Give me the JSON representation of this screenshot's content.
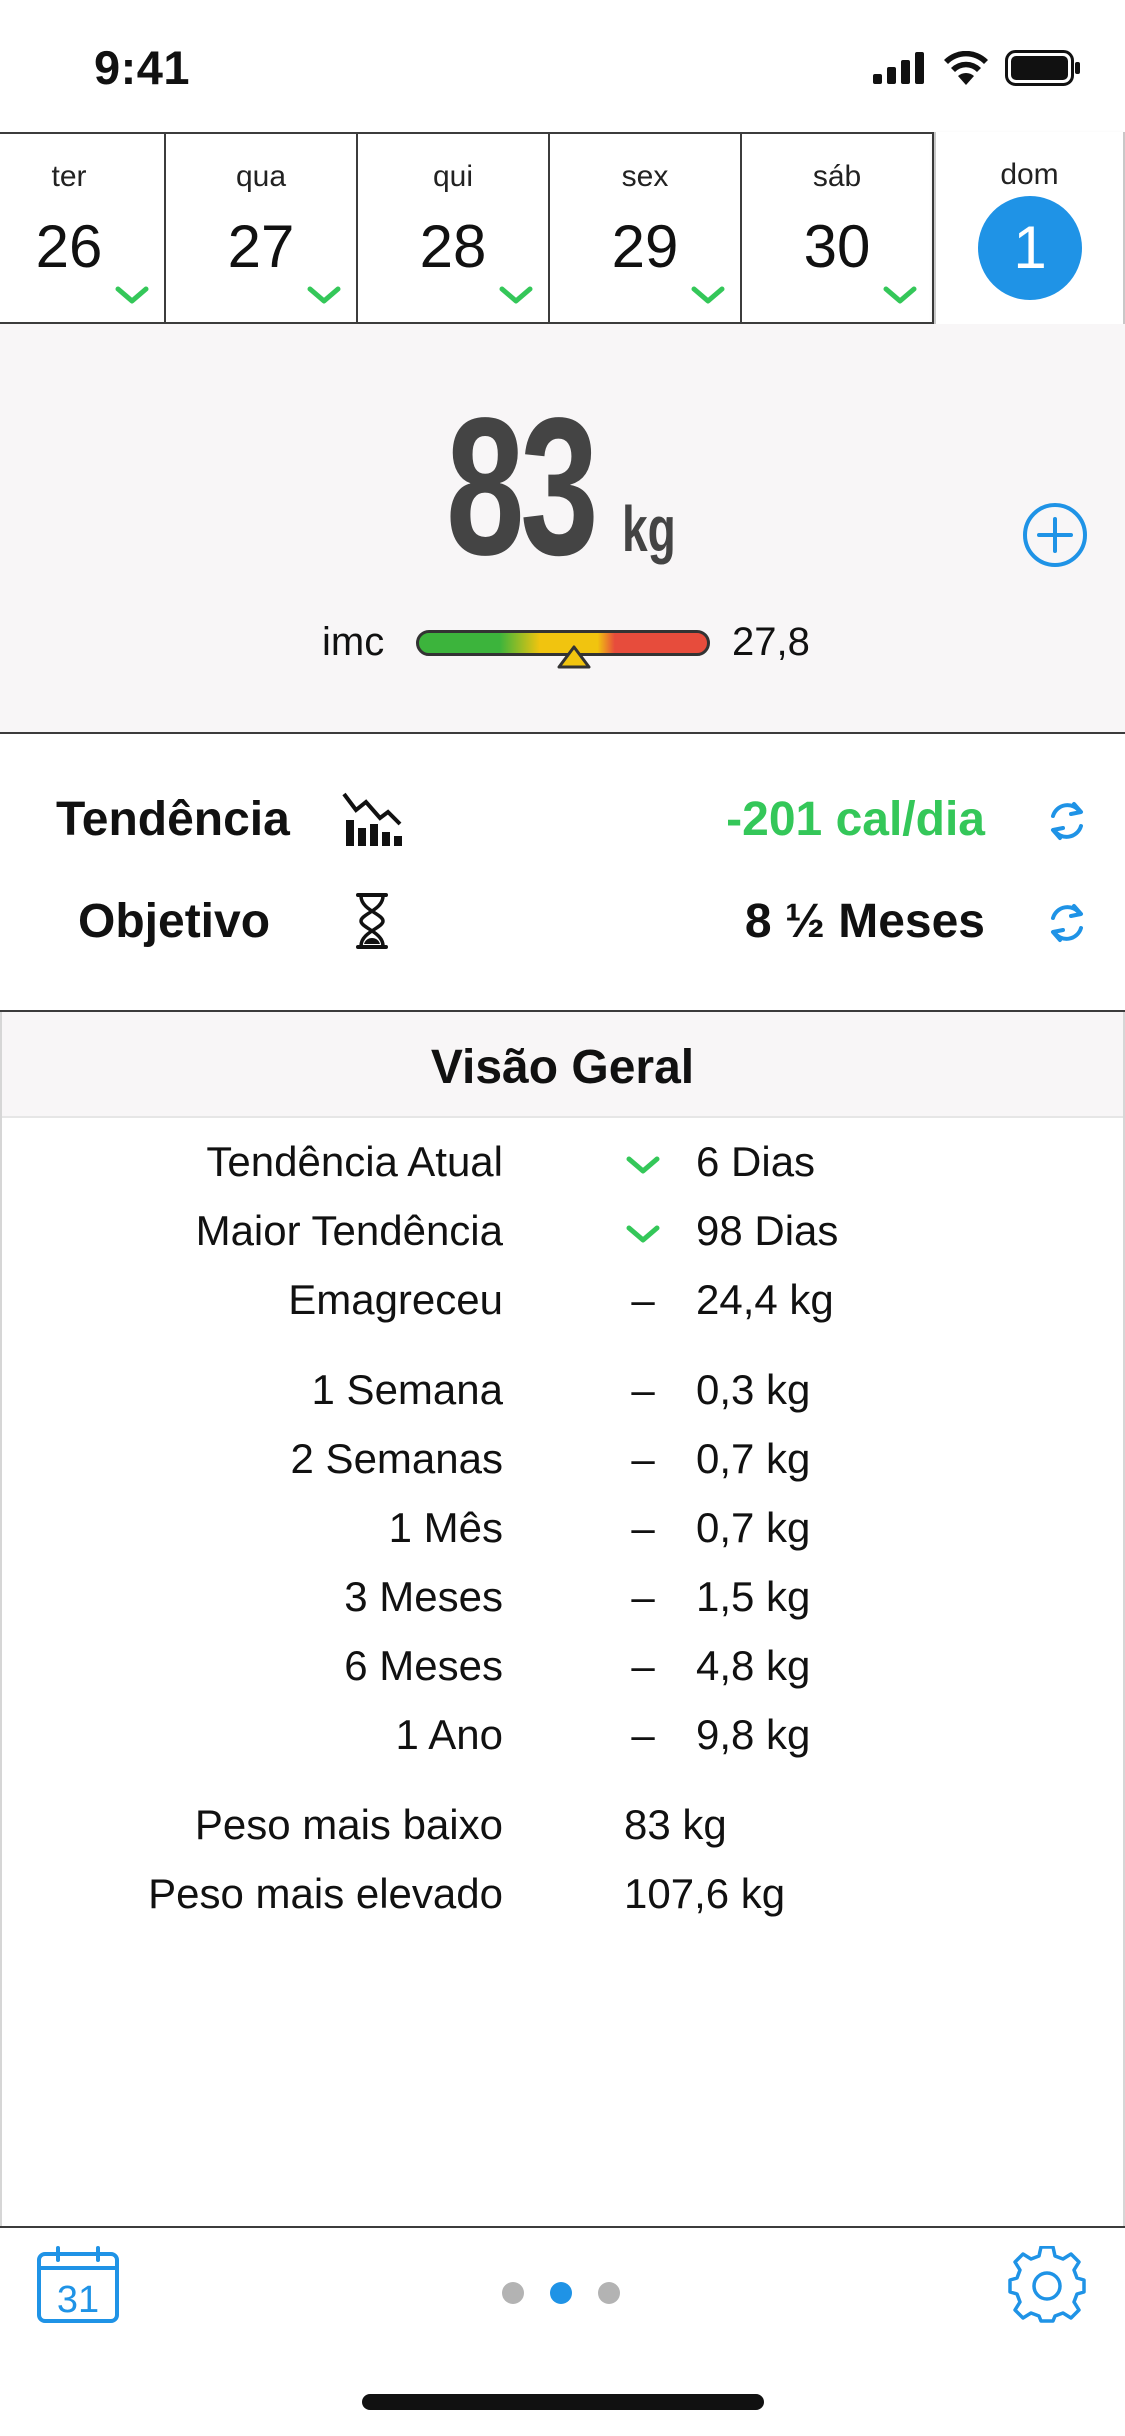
{
  "status_bar": {
    "time": "9:41"
  },
  "days": [
    {
      "name": "ter",
      "number": "26",
      "checked": true
    },
    {
      "name": "qua",
      "number": "27",
      "checked": true
    },
    {
      "name": "qui",
      "number": "28",
      "checked": true
    },
    {
      "name": "sex",
      "number": "29",
      "checked": true
    },
    {
      "name": "sáb",
      "number": "30",
      "checked": true
    }
  ],
  "selected_day": {
    "name": "dom",
    "number": "1"
  },
  "weight": {
    "value": "83",
    "unit": "kg"
  },
  "imc": {
    "label": "imc",
    "value": "27,8",
    "marker_fraction": 0.53
  },
  "trend": {
    "tendencia": {
      "label": "Tendência",
      "value": "-201 cal/dia",
      "color": "#34c759"
    },
    "objetivo": {
      "label": "Objetivo",
      "value": "8 ½ Meses"
    }
  },
  "overview": {
    "title": "Visão Geral",
    "streaks": [
      {
        "label": "Tendência Atual",
        "mark": "check",
        "value": "6 Dias"
      },
      {
        "label": "Maior Tendência",
        "mark": "check",
        "value": "98 Dias"
      },
      {
        "label": "Emagreceu",
        "mark": "–",
        "value": "24,4 kg"
      }
    ],
    "periods": [
      {
        "label": "1 Semana",
        "mark": "–",
        "value": "0,3 kg"
      },
      {
        "label": "2 Semanas",
        "mark": "–",
        "value": "0,7 kg"
      },
      {
        "label": "1 Mês",
        "mark": "–",
        "value": "0,7 kg"
      },
      {
        "label": "3 Meses",
        "mark": "–",
        "value": "1,5 kg"
      },
      {
        "label": "6 Meses",
        "mark": "–",
        "value": "4,8 kg"
      },
      {
        "label": "1 Ano",
        "mark": "–",
        "value": "9,8 kg"
      }
    ],
    "extremes": [
      {
        "label": "Peso mais baixo",
        "value": "83 kg"
      },
      {
        "label": "Peso mais elevado",
        "value": "107,6 kg"
      }
    ]
  },
  "bottom_bar": {
    "calendar_day": "31",
    "pages": 3,
    "active_page": 1
  },
  "colors": {
    "accent": "#1f93e6",
    "check": "#34c759",
    "bmi_green": "#3cb43c",
    "bmi_yellow": "#f1c40f",
    "bmi_red": "#e74c3c"
  },
  "icons": [
    "signal-icon",
    "wifi-icon",
    "battery-icon",
    "check-icon",
    "add-circle-icon",
    "trend-chart-icon",
    "hourglass-icon",
    "sync-icon",
    "calendar-icon",
    "gear-icon"
  ]
}
